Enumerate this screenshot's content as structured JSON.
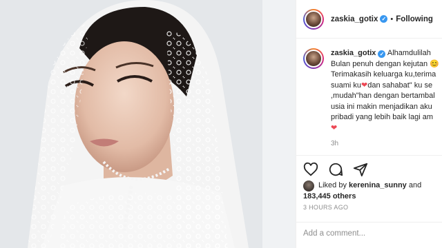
{
  "post": {
    "username": "zaskia_gotix",
    "follow_state": "Following",
    "caption_username": "zaskia_gotix",
    "caption_lines": [
      "Alhamdulilah",
      "Bulan penuh dengan kejutan",
      "Terimakasih keluarga ku,terima",
      "suami ku",
      "dan sahabat\" ku se",
      ",mudah\"han dengan bertambal",
      "usia ini makin menjadikan aku",
      "pribadi yang lebih baik lagi am"
    ],
    "caption_time": "3h",
    "liked_by_prefix": "Liked by",
    "liked_by_user": "kerenina_sunny",
    "liked_and": "and",
    "likes_count": "183,445 others",
    "timestamp": "3 HOURS AGO",
    "comment_placeholder": "Add a comment..."
  },
  "icons": {
    "verified": "verified-badge-icon",
    "heart": "heart-icon",
    "comment": "comment-icon",
    "share": "share-icon",
    "emoji_smile": "smile-emoji-icon",
    "emoji_heart": "red-heart-emoji-icon"
  },
  "colors": {
    "verified_blue": "#3897f0",
    "heart_red": "#ed4956",
    "muted_text": "#8e8e8e"
  }
}
